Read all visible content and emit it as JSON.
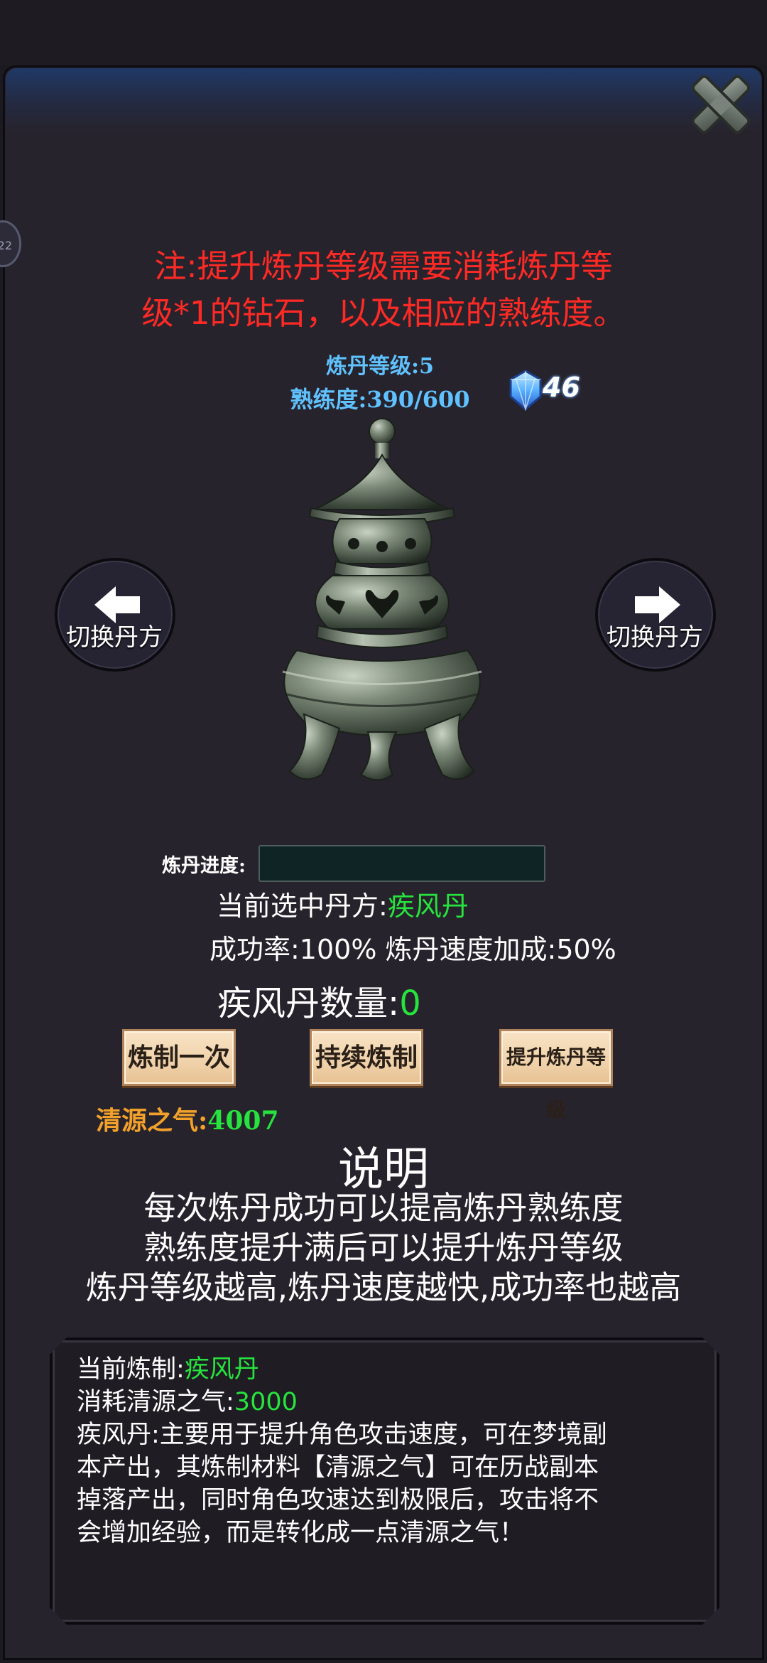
{
  "notice": {
    "line1": "注:提升炼丹等级需要消耗炼丹等",
    "line2": "级*1的钻石，以及相应的熟练度。"
  },
  "level": {
    "label": "炼丹等级:",
    "value": "5"
  },
  "proficiency": {
    "label": "熟练度:",
    "current": "390",
    "max": "600",
    "separator": "/"
  },
  "gems": {
    "count": "46",
    "icon": "diamond-icon"
  },
  "switch_left": {
    "label": "切换丹方",
    "icon": "arrow-left-icon"
  },
  "switch_right": {
    "label": "切换丹方",
    "icon": "arrow-right-icon"
  },
  "progress": {
    "label": "炼丹进度:",
    "value_percent": 0
  },
  "selected": {
    "label": "当前选中丹方:",
    "value": "疾风丹"
  },
  "rates": {
    "text": "成功率:100% 炼丹速度加成:50%"
  },
  "count": {
    "label": "疾风丹数量:",
    "value": "0"
  },
  "actions": {
    "craft_once": "炼制一次",
    "craft_continuous": "持续炼制",
    "upgrade_level": "提升炼丹等级"
  },
  "qi": {
    "label": "清源之气:",
    "value": "4007"
  },
  "description": {
    "title": "说明",
    "lines": [
      "每次炼丹成功可以提高炼丹熟练度",
      "熟练度提升满后可以提升炼丹等级",
      "炼丹等级越高,炼丹速度越快,成功率也越高"
    ]
  },
  "info": {
    "current_label": "当前炼制:",
    "current_value": "疾风丹",
    "cost_label": "消耗清源之气:",
    "cost_value": "3000",
    "body": [
      "疾风丹:主要用于提升角色攻击速度，可在梦境副",
      "本产出，其炼制材料【清源之气】可在历战副本",
      "掉落产出，同时角色攻速达到极限后，攻击将不",
      "会增加经验，而是转化成一点清源之气！"
    ]
  },
  "side_tab": {
    "text": "22"
  },
  "colors": {
    "notice": "#ff2a25",
    "level": "#5fc2ff",
    "highlight_green": "#26e43d",
    "qi_label": "#f2a22a",
    "button_bg": "#f0d2aa"
  }
}
